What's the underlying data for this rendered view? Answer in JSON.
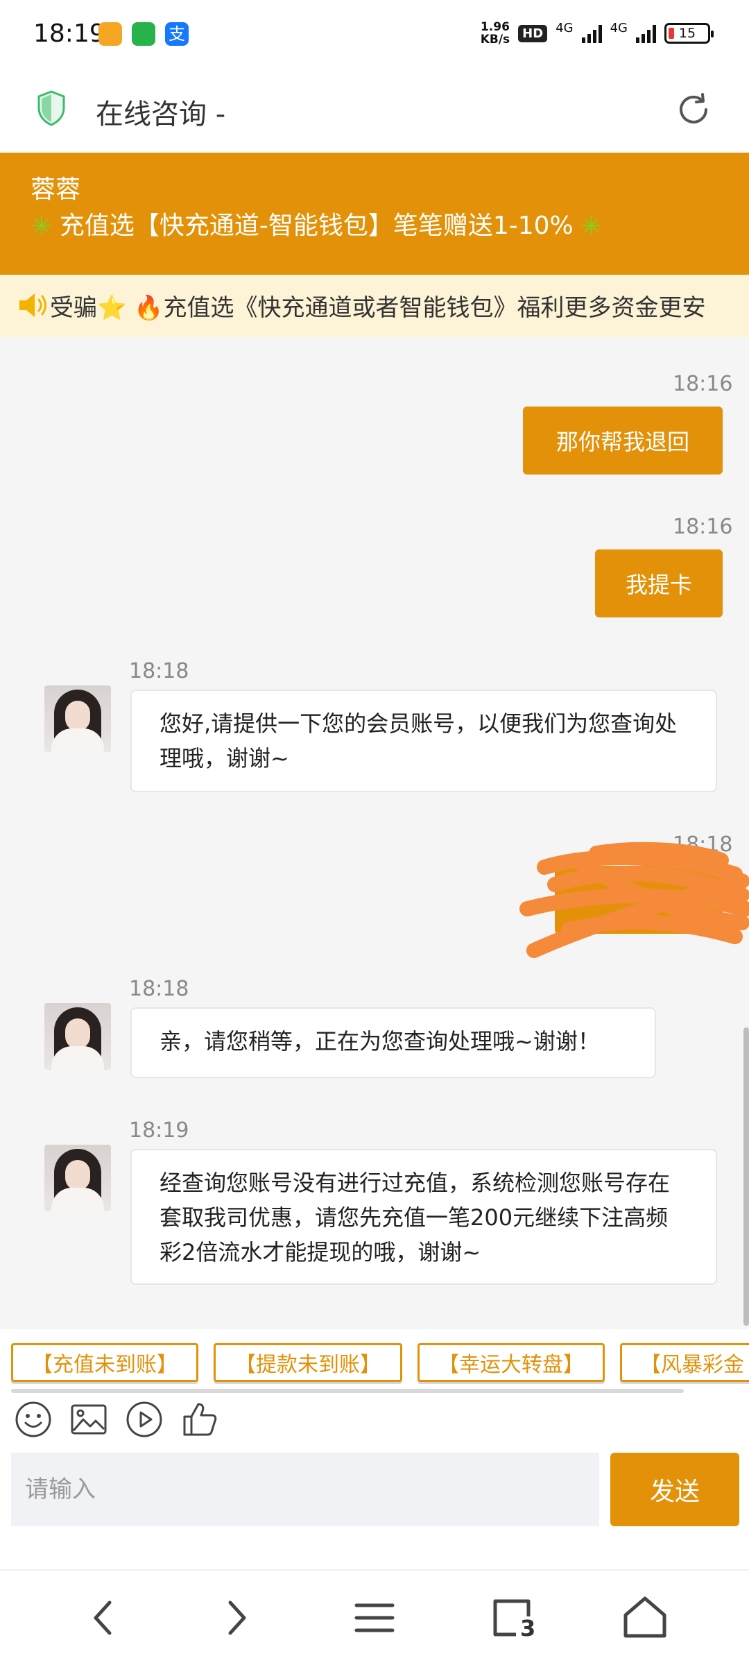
{
  "status_bar": {
    "time": "18:19",
    "net_speed_value": "1.96",
    "net_speed_unit": "KB/s",
    "hd_label": "HD",
    "net1": "4G",
    "net2": "4G",
    "battery": "15"
  },
  "header": {
    "title": "在线咨询 -"
  },
  "banner": {
    "agent_name": "蓉蓉",
    "promo": "充值选【快充通道-智能钱包】笔笔赠送1-10%"
  },
  "marquee": {
    "text": "受骗⭐ 🔥充值选《快充通道或者智能钱包》福利更多资金更安"
  },
  "messages": [
    {
      "time": "18:16",
      "text": "那你帮我退回"
    },
    {
      "time": "18:16",
      "text": "我提卡"
    },
    {
      "time": "18:18",
      "text": "您好,请提供一下您的会员账号，以便我们为您查询处理哦，谢谢~"
    },
    {
      "time": "18:18",
      "text": ""
    },
    {
      "time": "18:18",
      "text": "亲，请您稍等，正在为您查询处理哦~谢谢！"
    },
    {
      "time": "18:19",
      "text": "经查询您账号没有进行过充值，系统检测您账号存在套取我司优惠，请您先充值一笔200元继续下注高频彩2倍流水才能提现的哦，谢谢~"
    }
  ],
  "quick_replies": [
    "【充值未到账】",
    "【提款未到账】",
    "【幸运大转盘】",
    "【风暴彩金"
  ],
  "input": {
    "placeholder": "请输入",
    "send_label": "发送"
  },
  "nav": {
    "tabs_count": "3"
  },
  "colors": {
    "accent": "#e39108",
    "marquee_bg": "#fdf3d6"
  }
}
